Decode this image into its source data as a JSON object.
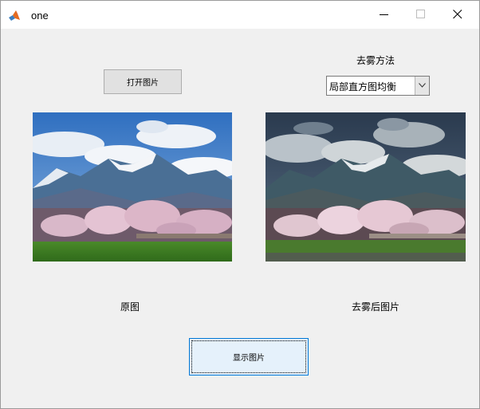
{
  "window": {
    "title": "one",
    "icon": "matlab-icon"
  },
  "titlebar_buttons": {
    "minimize_icon": "minimize-icon",
    "maximize_icon": "maximize-icon",
    "close_icon": "close-icon"
  },
  "controls": {
    "open_button_label": "打开图片",
    "method_label": "去雾方法",
    "method_select_value": "局部直方图均衡",
    "show_button_label": "显示图片"
  },
  "labels": {
    "original": "原图",
    "result": "去雾后图片"
  },
  "colors": {
    "window_bg": "#f0f0f0",
    "titlebar_bg": "#ffffff",
    "button_bg": "#e1e1e1",
    "focused_button_bg": "#e5f1fb",
    "focus_border": "#0078d7"
  }
}
